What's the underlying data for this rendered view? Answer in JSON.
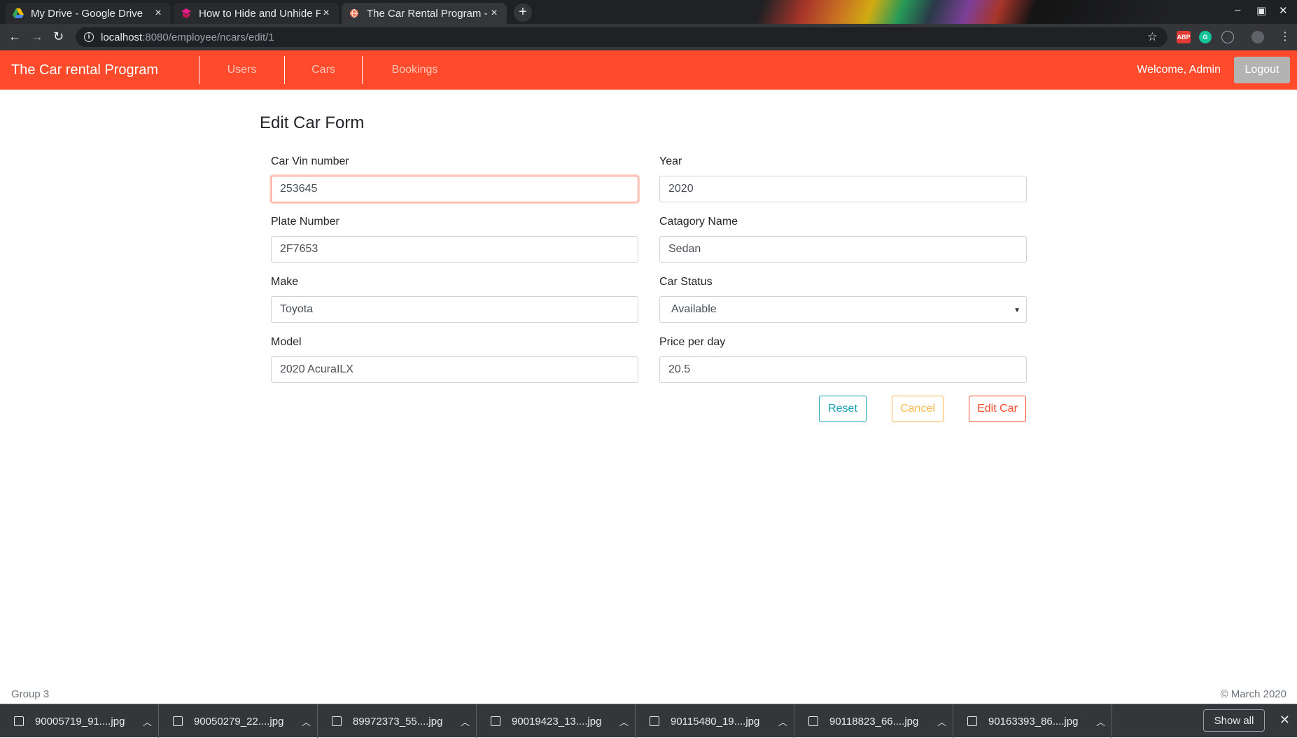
{
  "browser": {
    "tabs": [
      {
        "title": "My Drive - Google Drive",
        "icon": "google-drive-icon"
      },
      {
        "title": "How to Hide and Unhide F",
        "icon": "article-icon"
      },
      {
        "title": "The Car Rental Program - ",
        "icon": "globe-icon"
      }
    ],
    "url_host": "localhost",
    "url_path": ":8080/employee/ncars/edit/1"
  },
  "app": {
    "brand": "The Car rental Program",
    "nav": [
      "Users",
      "Cars",
      "Bookings"
    ],
    "welcome": "Welcome, Admin",
    "logout": "Logout",
    "accent_color": "#ff4b2b"
  },
  "form": {
    "title": "Edit Car Form",
    "fields": {
      "vin": {
        "label": "Car Vin number",
        "value": "253645"
      },
      "year": {
        "label": "Year",
        "value": "2020"
      },
      "plate": {
        "label": "Plate Number",
        "value": "2F7653"
      },
      "category": {
        "label": "Catagory Name",
        "value": "Sedan"
      },
      "make": {
        "label": "Make",
        "value": "Toyota"
      },
      "status": {
        "label": "Car Status",
        "value": "Available"
      },
      "model": {
        "label": "Model",
        "value": "2020 AcuraILX"
      },
      "price": {
        "label": "Price per day",
        "value": "20.5"
      }
    },
    "buttons": {
      "reset": "Reset",
      "cancel": "Cancel",
      "edit": "Edit Car"
    }
  },
  "footer": {
    "left": "Group 3",
    "right": "© March 2020"
  },
  "downloads": {
    "items": [
      "90005719_91....jpg",
      "90050279_22....jpg",
      "89972373_55....jpg",
      "90019423_13....jpg",
      "90115480_19....jpg",
      "90118823_66....jpg",
      "90163393_86....jpg"
    ],
    "show_all": "Show all"
  }
}
